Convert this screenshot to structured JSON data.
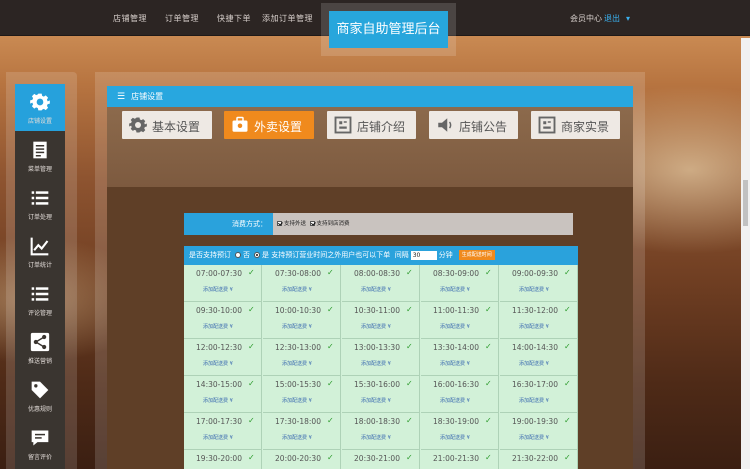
{
  "topnav": [
    "店铺管理",
    "订单管理",
    "快捷下单",
    "添加订单管理"
  ],
  "brand": "商家自助管理后台",
  "user": {
    "center": "会员中心",
    "logout": "退出"
  },
  "sidebar": [
    {
      "label": "店铺设置",
      "icon": "gear-icon",
      "active": true
    },
    {
      "label": "菜单管理",
      "icon": "document-icon"
    },
    {
      "label": "订单处理",
      "icon": "list-icon"
    },
    {
      "label": "订单统计",
      "icon": "chart-icon"
    },
    {
      "label": "评论管理",
      "icon": "list-icon"
    },
    {
      "label": "推送营销",
      "icon": "share-icon"
    },
    {
      "label": "优惠规则",
      "icon": "tag-icon"
    },
    {
      "label": "留言评价",
      "icon": "message-icon"
    }
  ],
  "content": {
    "title": "店铺设置"
  },
  "tabs": [
    {
      "label": "基本设置",
      "icon": "gear-icon"
    },
    {
      "label": "外卖设置",
      "icon": "toolbox-icon",
      "active": true
    },
    {
      "label": "店铺介绍",
      "icon": "window-icon"
    },
    {
      "label": "店铺公告",
      "icon": "speaker-icon"
    },
    {
      "label": "商家实景",
      "icon": "window-icon"
    }
  ],
  "payment": {
    "label": "消费方式：",
    "opt1": "支持外送",
    "opt2": "支持到店消费"
  },
  "reservation": {
    "label": "是否支持预订",
    "no": "否",
    "yes": "是 支持预订营业时间之外用户也可以下单",
    "interval_label": "间隔",
    "interval_value": "30",
    "unit": "分钟",
    "generate": "生成配送时间"
  },
  "slot_add_label": "添加配送费 ¥",
  "slots": [
    "07:00-07:30",
    "07:30-08:00",
    "08:00-08:30",
    "08:30-09:00",
    "09:00-09:30",
    "09:30-10:00",
    "10:00-10:30",
    "10:30-11:00",
    "11:00-11:30",
    "11:30-12:00",
    "12:00-12:30",
    "12:30-13:00",
    "13:00-13:30",
    "13:30-14:00",
    "14:00-14:30",
    "14:30-15:00",
    "15:00-15:30",
    "15:30-16:00",
    "16:00-16:30",
    "16:30-17:00",
    "17:00-17:30",
    "17:30-18:00",
    "18:00-18:30",
    "18:30-19:00",
    "19:00-19:30",
    "19:30-20:00",
    "20:00-20:30",
    "20:30-21:00",
    "21:00-21:30",
    "21:30-22:00"
  ]
}
